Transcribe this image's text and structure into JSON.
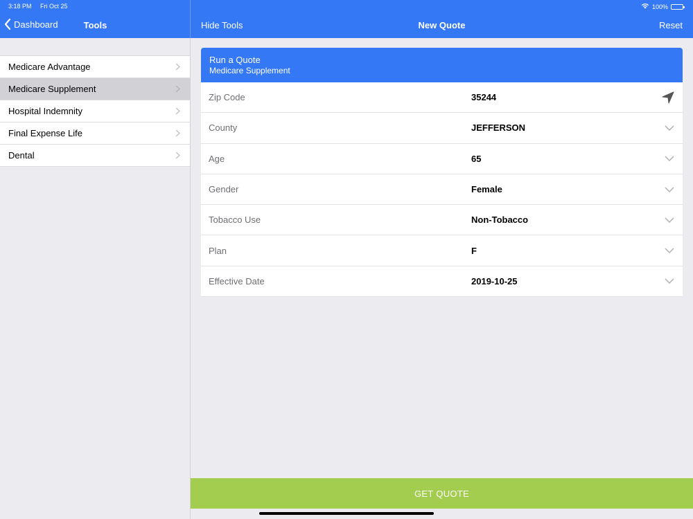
{
  "status": {
    "time": "3:18 PM",
    "date": "Fri Oct 25",
    "battery": "100%"
  },
  "nav": {
    "back_label": "Dashboard",
    "tools_title": "Tools",
    "hide_tools": "Hide Tools",
    "title": "New Quote",
    "reset": "Reset"
  },
  "sidebar": {
    "items": [
      {
        "label": "Medicare Advantage",
        "selected": false
      },
      {
        "label": "Medicare Supplement",
        "selected": true
      },
      {
        "label": "Hospital Indemnity",
        "selected": false
      },
      {
        "label": "Final Expense Life",
        "selected": false
      },
      {
        "label": "Dental",
        "selected": false
      }
    ]
  },
  "card": {
    "title": "Run a Quote",
    "subtitle": "Medicare Supplement",
    "fields": [
      {
        "label": "Zip Code",
        "value": "35244",
        "icon": "location-arrow-icon"
      },
      {
        "label": "County",
        "value": "JEFFERSON",
        "icon": "chevron-down-icon"
      },
      {
        "label": "Age",
        "value": "65",
        "icon": "chevron-down-icon"
      },
      {
        "label": "Gender",
        "value": "Female",
        "icon": "chevron-down-icon"
      },
      {
        "label": "Tobacco Use",
        "value": "Non-Tobacco",
        "icon": "chevron-down-icon"
      },
      {
        "label": "Plan",
        "value": "F",
        "icon": "chevron-down-icon"
      },
      {
        "label": "Effective Date",
        "value": "2019-10-25",
        "icon": "chevron-down-icon"
      }
    ]
  },
  "actions": {
    "get_quote": "GET QUOTE"
  },
  "colors": {
    "accent": "#3478f6",
    "button": "#a3cd4f",
    "selected": "#d1d1d6"
  }
}
